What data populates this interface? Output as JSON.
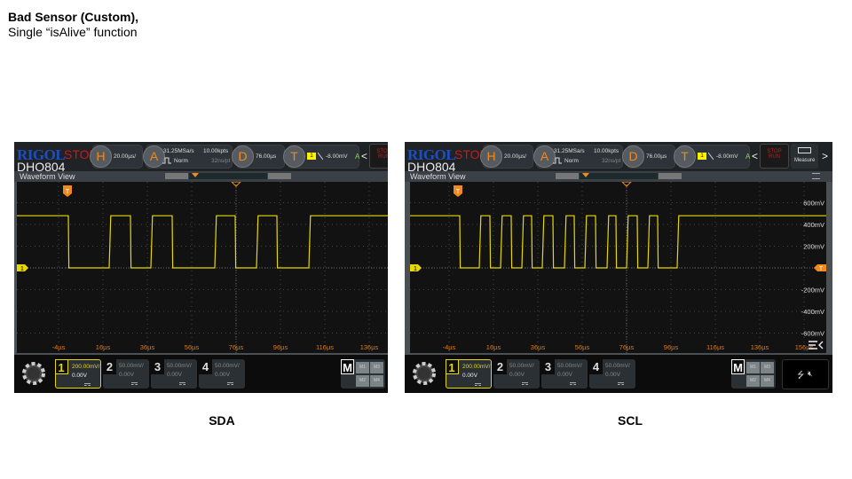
{
  "slide": {
    "title": "Bad Sensor (Custom),",
    "subtitle": "Single “isAlive” function"
  },
  "colors": {
    "trace": "#e6d800",
    "accent": "#f08a1c",
    "stop": "#d01818"
  },
  "scopes": [
    {
      "caption": "SDA",
      "brand": "RIGOL",
      "state": "STOP",
      "model": "DHO804",
      "view": "Waveform View",
      "h_key": "H",
      "timebase": "20.00µs/",
      "a_key": "A",
      "sample_rate": "31.25MSa/s",
      "mem_depth": "10.00kpts",
      "acq_mode": "Norm",
      "sample_interval": "32ns/pt",
      "d_key": "D",
      "delay": "76.00µs",
      "t_key": "T",
      "trig_source": "1",
      "trig_level": "-8.00mV",
      "trig_mode": "A",
      "nav_prev": "<",
      "stop_run": "STOP RUN",
      "channels": [
        {
          "num": "1",
          "scale": "200.00mV/",
          "offset": "0.00V"
        },
        {
          "num": "2",
          "scale": "50.00mV/",
          "offset": "0.00V"
        },
        {
          "num": "3",
          "scale": "50.00mV/",
          "offset": "0.00V"
        },
        {
          "num": "4",
          "scale": "50.00mV/",
          "offset": "0.00V"
        }
      ],
      "math": {
        "label": "M",
        "items": [
          "M1",
          "M3",
          "M2",
          "M4"
        ]
      },
      "ch_marker": "1",
      "trig_marker": "T",
      "time_labels": [
        "-4µs",
        "16µs",
        "36µs",
        "56µs",
        "76µs",
        "96µs",
        "116µs",
        "136µs",
        "156µs"
      ],
      "waveform": {
        "high_mV": 480,
        "low_mV": 0,
        "start": "high",
        "edges_us": [
          0.4,
          18.8,
          28.4,
          37.6,
          47.2,
          66.4,
          75.6,
          85.2,
          94.4,
          108.8
        ]
      }
    },
    {
      "caption": "SCL",
      "brand": "RIGOL",
      "state": "STOP",
      "model": "DHO804",
      "view": "Waveform View",
      "h_key": "H",
      "timebase": "20.00µs/",
      "a_key": "A",
      "sample_rate": "31.25MSa/s",
      "mem_depth": "10.00kpts",
      "acq_mode": "Norm",
      "sample_interval": "32ns/pt",
      "d_key": "D",
      "delay": "76.00µs",
      "t_key": "T",
      "trig_source": "1",
      "trig_level": "-8.00mV",
      "trig_mode": "A",
      "nav_prev": "<",
      "nav_next": ">",
      "stop_run": "STOP RUN",
      "measure": "Measure",
      "channels": [
        {
          "num": "1",
          "scale": "200.00mV/",
          "offset": "0.00V"
        },
        {
          "num": "2",
          "scale": "50.00mV/",
          "offset": "0.00V"
        },
        {
          "num": "3",
          "scale": "50.00mV/",
          "offset": "0.00V"
        },
        {
          "num": "4",
          "scale": "50.00mV/",
          "offset": "0.00V"
        }
      ],
      "math": {
        "label": "M",
        "items": [
          "M1",
          "M3",
          "M2",
          "M4"
        ]
      },
      "ch_marker": "1",
      "trig_marker": "T",
      "volt_labels": [
        "600mV",
        "400mV",
        "200mV",
        "-200mV",
        "-400mV",
        "-600mV"
      ],
      "volt_values": [
        600,
        400,
        200,
        -200,
        -400,
        -600
      ],
      "time_labels": [
        "-4µs",
        "16µs",
        "36µs",
        "56µs",
        "76µs",
        "96µs",
        "116µs",
        "136µs",
        "156µs"
      ],
      "waveform": {
        "high_mV": 480,
        "low_mV": 0,
        "start": "high",
        "edges_us": [
          0.8,
          9.6,
          14.4,
          19.2,
          24,
          28.8,
          33.2,
          38,
          42.8,
          48,
          52.4,
          57.2,
          62,
          67.2,
          71.2,
          76,
          80.8,
          85.6,
          90,
          98.8
        ]
      }
    }
  ]
}
